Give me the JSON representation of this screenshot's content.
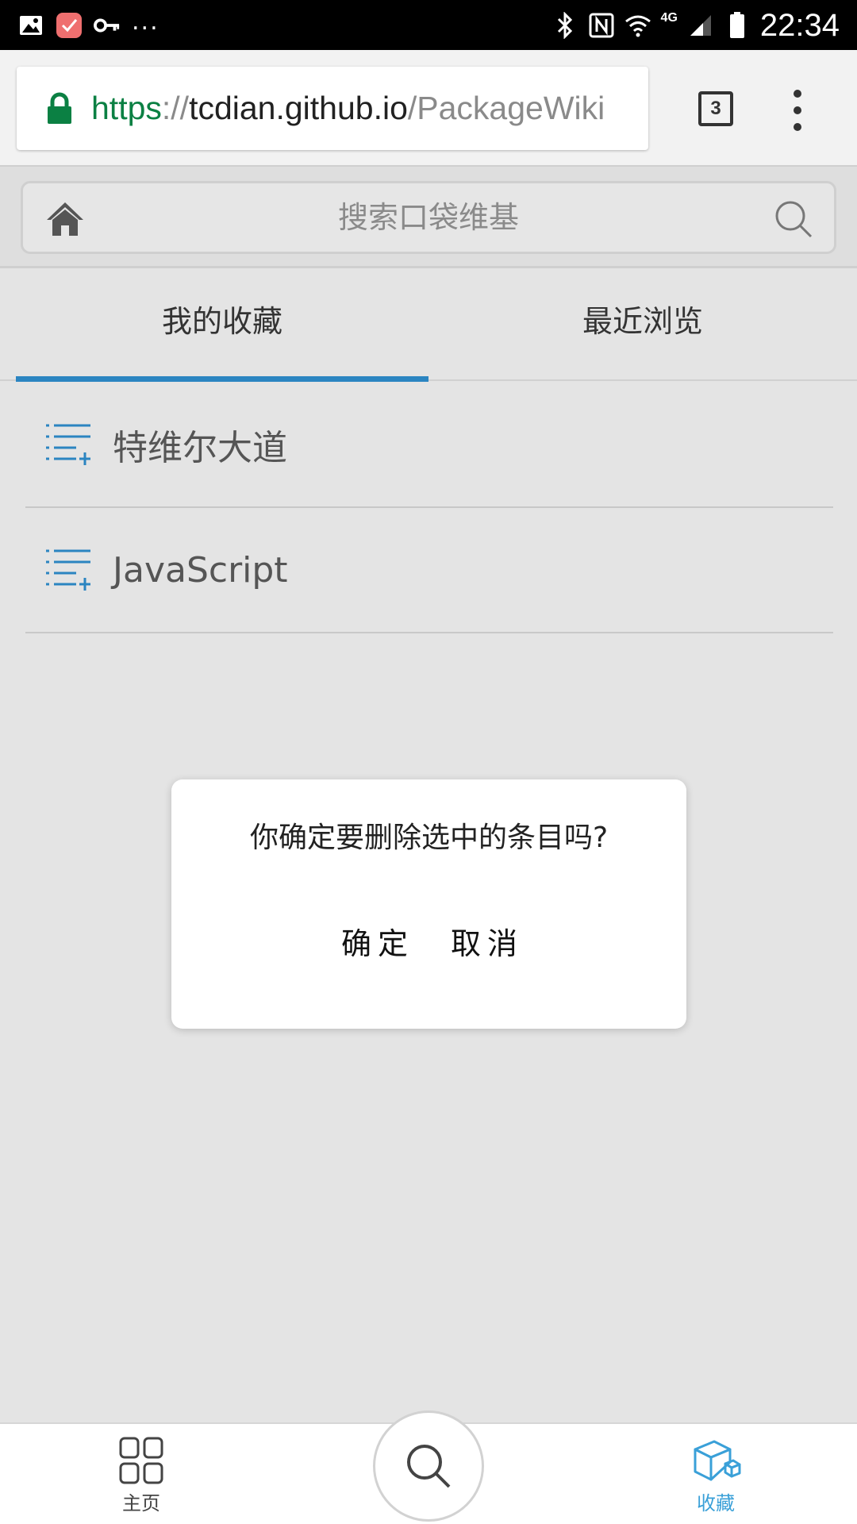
{
  "status_bar": {
    "time": "22:34",
    "network": "4G",
    "overflow": "..."
  },
  "browser": {
    "url_scheme": "https",
    "url_sep": "://",
    "url_host": "tcdian.github.io",
    "url_path": "/PackageWiki",
    "tab_count": "3"
  },
  "header": {
    "search_placeholder": "搜索口袋维基"
  },
  "tabs": [
    {
      "label": "我的收藏",
      "active": true
    },
    {
      "label": "最近浏览",
      "active": false
    }
  ],
  "list": {
    "items": [
      {
        "label": "特维尔大道"
      },
      {
        "label": "JavaScript"
      }
    ]
  },
  "dialog": {
    "message": "你确定要删除选中的条目吗?",
    "confirm_label": "确定",
    "cancel_label": "取消"
  },
  "bottom_nav": {
    "home_label": "主页",
    "favorites_label": "收藏"
  },
  "colors": {
    "accent": "#2b85c1",
    "url_secure": "#0b8043",
    "background": "#e4e4e4"
  }
}
